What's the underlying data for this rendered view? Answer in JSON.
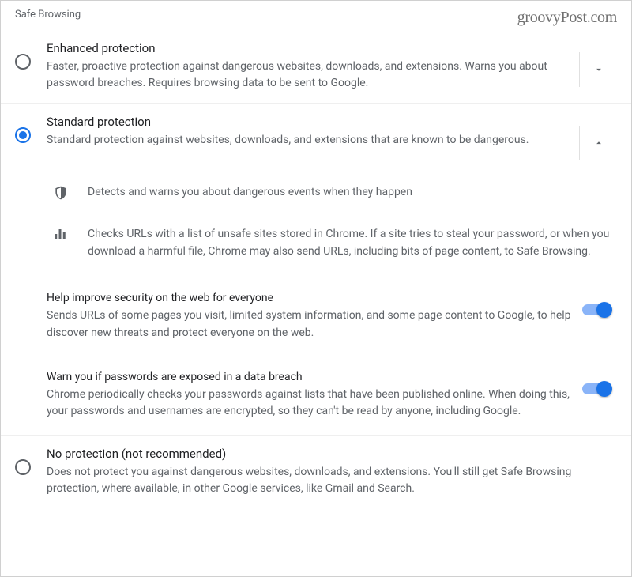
{
  "header": {
    "section_title": "Safe Browsing"
  },
  "watermark": "groovyPost.com",
  "options": {
    "enhanced": {
      "title": "Enhanced protection",
      "desc": "Faster, proactive protection against dangerous websites, downloads, and extensions. Warns you about password breaches. Requires browsing data to be sent to Google."
    },
    "standard": {
      "title": "Standard protection",
      "desc": "Standard protection against websites, downloads, and extensions that are known to be dangerous.",
      "details": {
        "warn": "Detects and warns you about dangerous events when they happen",
        "urls": "Checks URLs with a list of unsafe sites stored in Chrome. If a site tries to steal your password, or when you download a harmful file, Chrome may also send URLs, including bits of page content, to Safe Browsing."
      },
      "sub": {
        "improve": {
          "title": "Help improve security on the web for everyone",
          "desc": "Sends URLs of some pages you visit, limited system information, and some page content to Google, to help discover new threats and protect everyone on the web."
        },
        "breach": {
          "title": "Warn you if passwords are exposed in a data breach",
          "desc": "Chrome periodically checks your passwords against lists that have been published online. When doing this, your passwords and usernames are encrypted, so they can't be read by anyone, including Google."
        }
      }
    },
    "none": {
      "title": "No protection (not recommended)",
      "desc": "Does not protect you against dangerous websites, downloads, and extensions. You'll still get Safe Browsing protection, where available, in other Google services, like Gmail and Search."
    }
  }
}
